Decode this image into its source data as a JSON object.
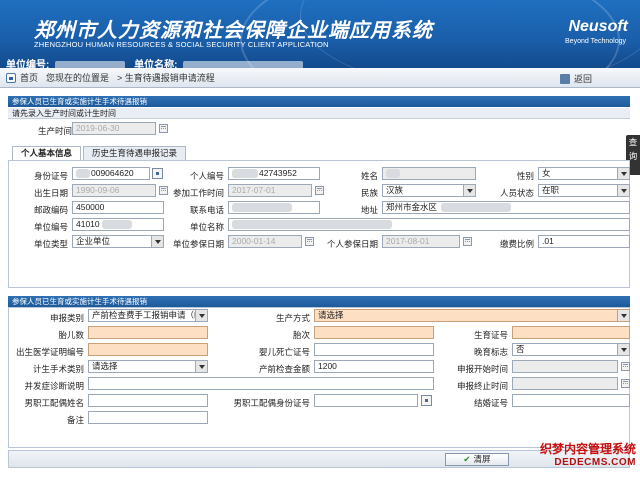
{
  "header": {
    "title_cn": "郑州市人力资源和社会保障企业端应用系统",
    "title_en": "ZHENGZHOU HUMAN RESOURCES & SOCIAL SECURITY CLIENT APPLICATION",
    "brand": "Neusoft",
    "brand_sub": "Beyond Technology",
    "unit_no_label": "单位编号:",
    "unit_name_label": "单位名称:"
  },
  "nav": {
    "home": "首页",
    "location_prefix": "您现在的位置是",
    "breadcrumb": "> 生育待遇报销申请流程",
    "back": "返回"
  },
  "section1": {
    "title": "参保人员已生育或实施计生手术待遇报销",
    "prompt": "请先录入生产时间或计生时间",
    "birth_time_label": "生产时间",
    "birth_time_value": "2019-06-30"
  },
  "tabs": [
    "个人基本信息",
    "历史生育待遇申报记录"
  ],
  "side_tab": "查询",
  "personal": {
    "id_no_label": "身份证号",
    "id_no_value": "009064620",
    "person_no_label": "个人编号",
    "person_no_value": "42743952",
    "name_label": "姓名",
    "name_value": "",
    "gender_label": "性别",
    "gender_value": "女",
    "birth_date_label": "出生日期",
    "birth_date_value": "1990-09-06",
    "work_date_label": "参加工作时间",
    "work_date_value": "2017-07-01",
    "ethnic_label": "民族",
    "ethnic_value": "汉族",
    "status_label": "人员状态",
    "status_value": "在职",
    "postcode_label": "邮政编码",
    "postcode_value": "450000",
    "phone_label": "联系电话",
    "phone_value": "",
    "address_label": "地址",
    "address_value": "郑州市金水区",
    "unit_no_label": "单位编号",
    "unit_no_value": "41010",
    "unit_name_label": "单位名称",
    "unit_name_value": "",
    "unit_type_label": "单位类型",
    "unit_type_value": "企业单位",
    "unit_ins_date_label": "单位参保日期",
    "unit_ins_date_value": "2000-01-14",
    "person_ins_date_label": "个人参保日期",
    "person_ins_date_value": "2017-08-01",
    "pay_ratio_label": "缴费比例",
    "pay_ratio_value": ".01"
  },
  "section2": {
    "title": "参保人员已生育或实施计生手术待遇报销",
    "apply_type_label": "申报类别",
    "apply_type_value": "产前检查费手工报销申请（B",
    "delivery_label": "生产方式",
    "delivery_value": "请选择",
    "fetus_count_label": "胎儿数",
    "fetus_count_value": "",
    "fetus_order_label": "胎次",
    "fetus_order_value": "",
    "birth_cert_label": "生育证号",
    "birth_cert_value": "",
    "medical_cert_label": "出生医学证明编号",
    "medical_cert_value": "",
    "death_cert_label": "婴儿死亡证号",
    "death_cert_value": "",
    "late_marriage_label": "晚育标志",
    "late_marriage_value": "否",
    "surgery_type_label": "计生手术类别",
    "surgery_type_value": "请选择",
    "prenatal_amount_label": "产前检查金额",
    "prenatal_amount_value": "1200",
    "apply_start_label": "申报开始时间",
    "apply_start_value": "",
    "complication_label": "并发症诊断说明",
    "complication_value": "",
    "apply_end_label": "申报终止时间",
    "apply_end_value": "",
    "spouse_name_label": "男职工配偶姓名",
    "spouse_name_value": "",
    "spouse_id_label": "男职工配偶身份证号",
    "spouse_id_value": "",
    "marriage_cert_label": "结婚证号",
    "marriage_cert_value": "",
    "remark_label": "备注",
    "remark_value": ""
  },
  "footer": {
    "clear_button": "清屏"
  },
  "watermark": {
    "line1": "织梦内容管理系统",
    "line2": "DEDECMS.COM"
  }
}
